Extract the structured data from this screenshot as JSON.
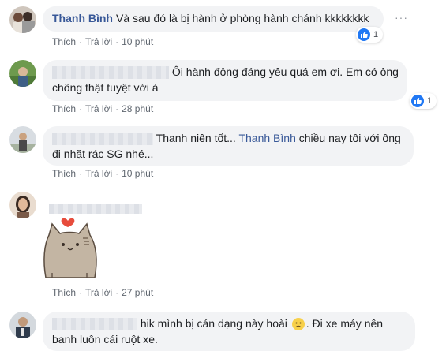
{
  "comments": [
    {
      "author": "Thanh Bình",
      "text": "Và sau đó là bị hành ở phòng hành chánh kkkkkkkk",
      "like_label": "Thích",
      "reply_label": "Trả lời",
      "time": "10 phút",
      "reactions": "1"
    },
    {
      "text_line1": "Ôi hành đông đáng yêu quá em ơi. Em có ông",
      "text_line2": "chông thật tuyệt vời à",
      "like_label": "Thích",
      "reply_label": "Trả lời",
      "time": "28 phút",
      "reactions": "1"
    },
    {
      "text_line1_a": "Thanh niên tốt...",
      "mention": "Thanh Bình",
      "text_line1_b": "chiều nay tôi với ông",
      "text_line2": "đi nhặt rác SG nhé...",
      "like_label": "Thích",
      "reply_label": "Trả lời",
      "time": "10 phút"
    },
    {
      "sticker": "pusheen-cat-heart",
      "like_label": "Thích",
      "reply_label": "Trả lời",
      "time": "27 phút"
    },
    {
      "text_line1_a": "hik mình bị cán dạng này hoài",
      "text_line1_b": ". Đi xe máy nên",
      "text_line2": "banh luôn cái ruột xe."
    }
  ],
  "colors": {
    "link": "#385898",
    "bubble": "#f2f3f5",
    "like_blue": "#2078f4",
    "meta": "#606770"
  },
  "icons": [
    "more-options-icon",
    "like-reaction-icon",
    "worried-emoji-icon"
  ]
}
